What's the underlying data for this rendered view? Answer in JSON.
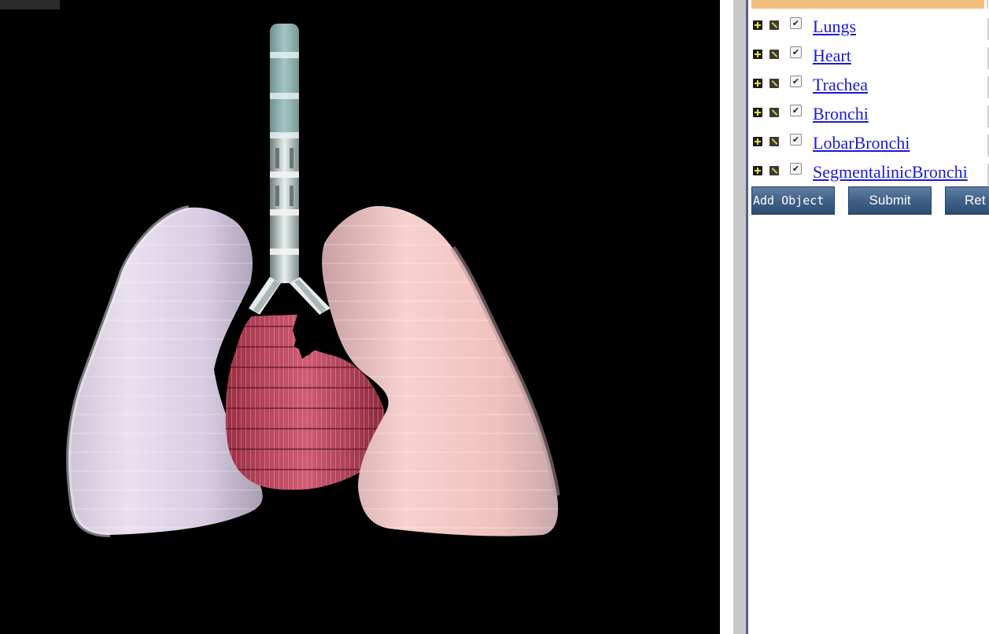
{
  "viewer": {
    "scene_objects": [
      "left-lung",
      "right-lung",
      "heart",
      "trachea",
      "bronchi"
    ]
  },
  "objects_panel": {
    "items": [
      {
        "label": "Lungs",
        "checked": true
      },
      {
        "label": "Heart",
        "checked": true
      },
      {
        "label": "Trachea",
        "checked": true
      },
      {
        "label": "Bronchi",
        "checked": true
      },
      {
        "label": "LobarBronchi",
        "checked": true
      },
      {
        "label": "SegmentalinicBronchi",
        "checked": true
      }
    ],
    "check_glyph": "✔",
    "icons": [
      "plus-icon",
      "pencil-icon"
    ],
    "buttons": {
      "add_object": "Add Object",
      "submit": "Submit",
      "reset": "Ret"
    },
    "colors": {
      "header": "#f3bd7c",
      "link": "#1a1ad6",
      "button": "#3e5f86"
    }
  }
}
